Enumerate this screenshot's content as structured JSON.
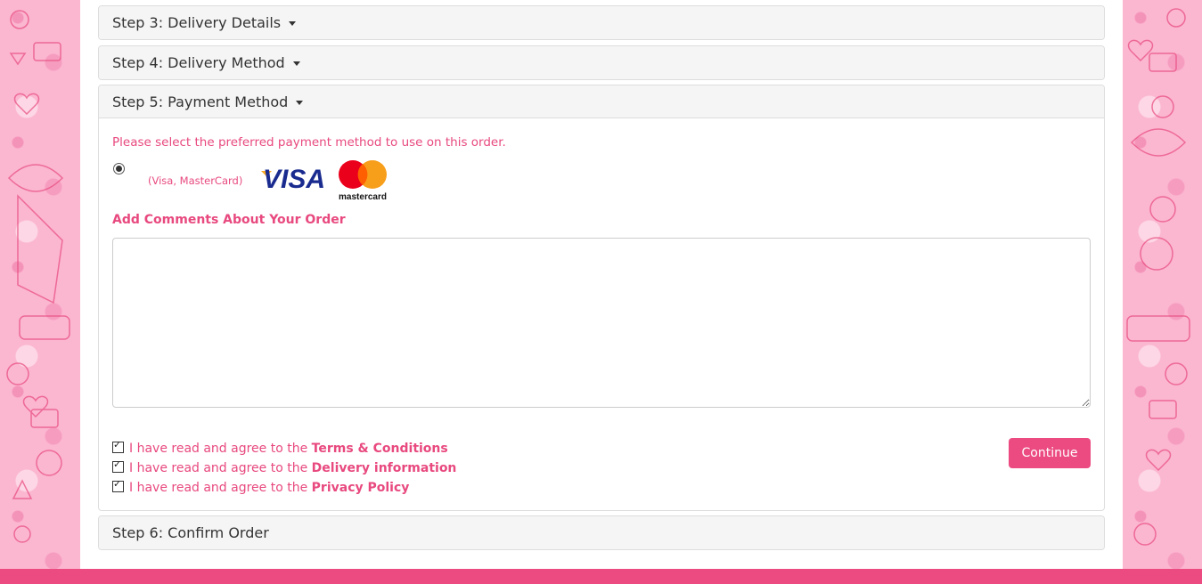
{
  "steps": {
    "step3": "Step 3: Delivery Details",
    "step4": "Step 4: Delivery Method",
    "step5": "Step 5: Payment Method",
    "step6": "Step 6: Confirm Order"
  },
  "payment": {
    "intro": "Please select the preferred payment method to use on this order.",
    "option_label": "(Visa, MasterCard)",
    "visa_text": "VISA",
    "mastercard_text": "mastercard",
    "selected": true
  },
  "comments": {
    "title": "Add Comments About Your Order",
    "value": ""
  },
  "agreements": [
    {
      "prefix": "I have read and agree to the ",
      "link": "Terms & Conditions",
      "checked": true
    },
    {
      "prefix": "I have read and agree to the ",
      "link": "Delivery information",
      "checked": true
    },
    {
      "prefix": "I have read and agree to the ",
      "link": "Privacy Policy",
      "checked": true
    }
  ],
  "buttons": {
    "continue": "Continue"
  },
  "colors": {
    "accent": "#ec4b82",
    "text_pink": "#e8497e",
    "heading_bg": "#f5f5f5"
  },
  "icons": [
    "caret-down-icon",
    "visa-logo-icon",
    "mastercard-logo-icon",
    "checkbox-checked-icon",
    "radio-selected-icon",
    "resize-handle-icon"
  ]
}
